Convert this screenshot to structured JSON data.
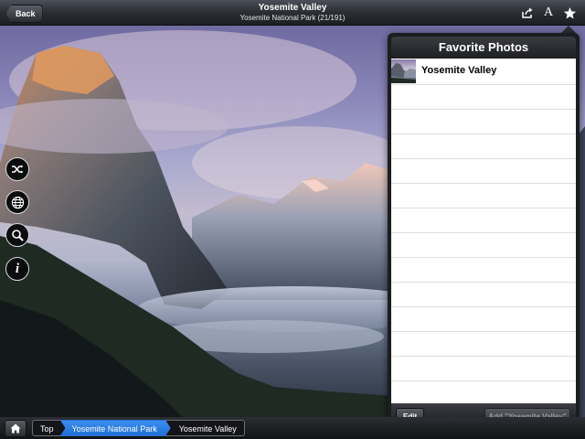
{
  "nav": {
    "back_label": "Back",
    "title": "Yosemite Valley",
    "subtitle": "Yosemite National Park (21/191)"
  },
  "icons": {
    "share": "share-icon",
    "text_size": "text-size-icon",
    "favorites": "star-icon",
    "shuffle": "shuffle-icon",
    "globe": "globe-icon",
    "search": "search-icon",
    "info": "info-icon",
    "home": "home-icon"
  },
  "text_size_glyph": "A",
  "info_glyph": "i",
  "favorites": {
    "title": "Favorite Photos",
    "items": [
      {
        "label": "Yosemite Valley"
      }
    ],
    "edit_label": "Edit",
    "add_label": "Add \"Yosemite Valley\""
  },
  "breadcrumb": {
    "items": [
      "Top",
      "Yosemite National Park",
      "Yosemite Valley"
    ],
    "active_index": 1
  },
  "colors": {
    "accent": "#2b7de9",
    "toolbar": "#2b2e34"
  }
}
